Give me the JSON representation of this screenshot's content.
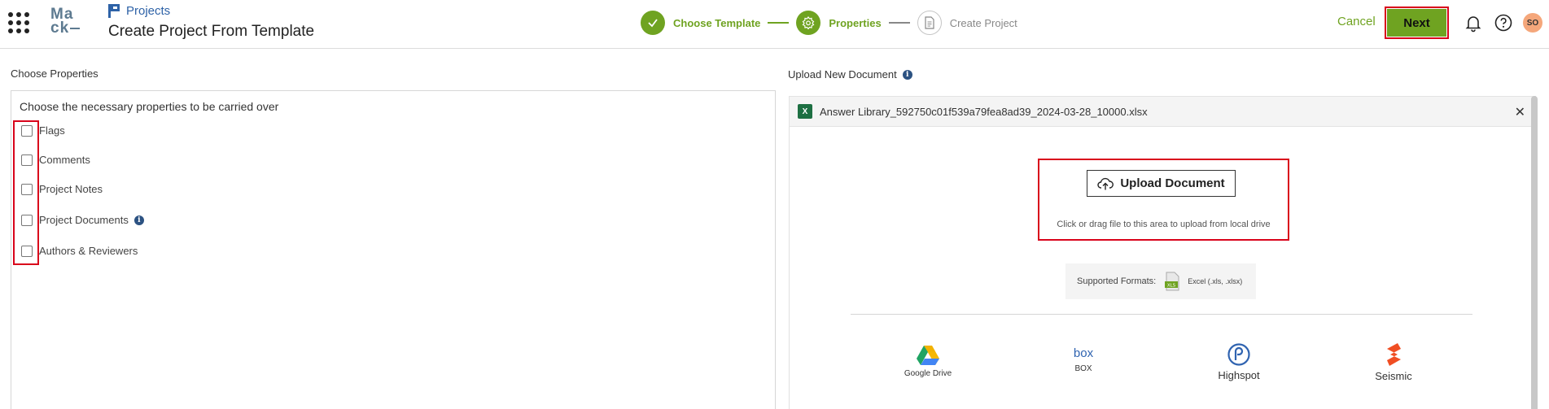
{
  "header": {
    "logo_line1": "Ma",
    "logo_line2": "ck",
    "breadcrumb": "Projects",
    "title": "Create Project From Template",
    "steps": [
      {
        "label": "Choose Template",
        "state": "done"
      },
      {
        "label": "Properties",
        "state": "active"
      },
      {
        "label": "Create Project",
        "state": "pending"
      }
    ],
    "cancel_label": "Cancel",
    "next_label": "Next",
    "avatar_initials": "SO"
  },
  "left": {
    "section_label": "Choose Properties",
    "heading": "Choose the necessary properties to be carried over",
    "properties": [
      {
        "label": "Flags",
        "checked": false
      },
      {
        "label": "Comments",
        "checked": false
      },
      {
        "label": "Project Notes",
        "checked": false
      },
      {
        "label": "Project Documents",
        "checked": false,
        "info": true
      },
      {
        "label": "Authors & Reviewers",
        "checked": false
      }
    ]
  },
  "right": {
    "section_label": "Upload New Document",
    "file_name": "Answer Library_592750c01f539a79fea8ad39_2024-03-28_10000.xlsx",
    "upload_button": "Upload Document",
    "upload_hint": "Click or drag file to this area to upload from local drive",
    "formats_label": "Supported Formats:",
    "formats_value": "Excel (.xls, .xlsx)",
    "sources": [
      {
        "label": "Google Drive",
        "icon": "google-drive-icon"
      },
      {
        "label": "BOX",
        "icon": "box-icon"
      },
      {
        "label": "Highspot",
        "icon": "highspot-icon"
      },
      {
        "label": "Seismic",
        "icon": "seismic-icon"
      }
    ]
  },
  "colors": {
    "accent_green": "#6fa321",
    "highlight_red": "#d9041b",
    "link_blue": "#2e62a7",
    "avatar_bg": "#f5a77b"
  }
}
